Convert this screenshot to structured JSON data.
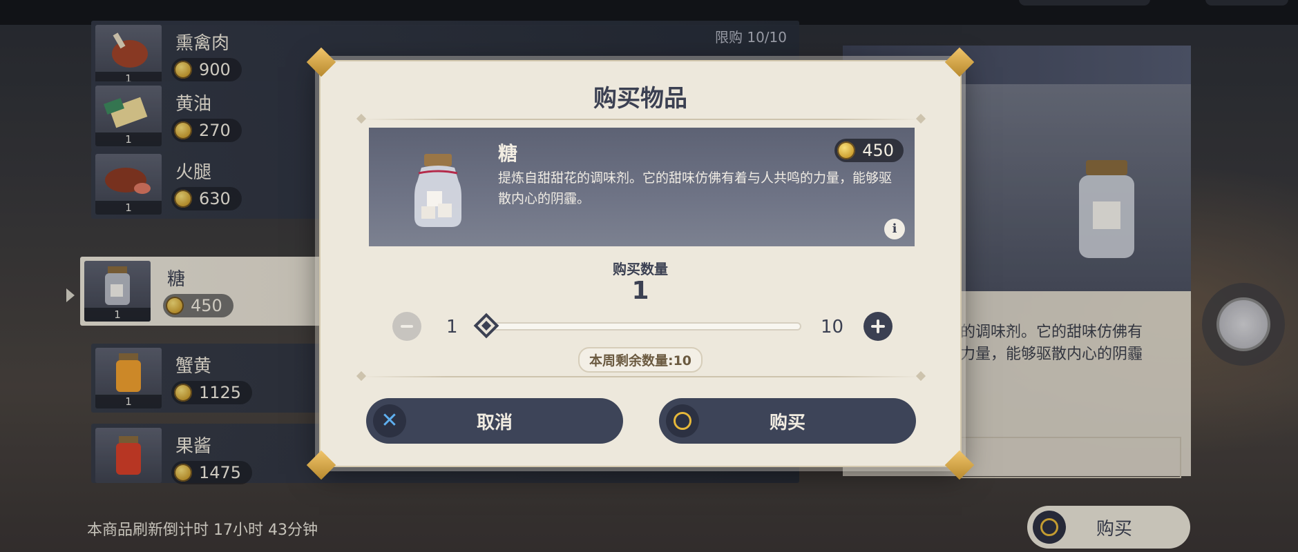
{
  "shop": {
    "items": [
      {
        "name": "熏禽肉",
        "price": "900",
        "qty": "1",
        "limit": "限购 10/10"
      },
      {
        "name": "黄油",
        "price": "270",
        "qty": "1"
      },
      {
        "name": "火腿",
        "price": "630",
        "qty": "1"
      },
      {
        "name": "糖",
        "price": "450",
        "qty": "1"
      },
      {
        "name": "蟹黄",
        "price": "1125",
        "qty": "1"
      },
      {
        "name": "果酱",
        "price": "1475",
        "qty": "1"
      }
    ],
    "refresh_text": "本商品刷新倒计时 17小时 43分钟",
    "buy_label": "购买"
  },
  "detail": {
    "desc": "的调味剂。它的甜味仿佛有\n力量，能够驱散内心的阴霾"
  },
  "dialog": {
    "title": "购买物品",
    "item": {
      "name": "糖",
      "price": "450",
      "desc": "提炼自甜甜花的调味剂。它的甜味仿佛有着与人共鸣的力量，能够驱散内心的阴霾。"
    },
    "qty_label": "购买数量",
    "qty_value": "1",
    "slider_min": "1",
    "slider_max": "10",
    "remaining": "本周剩余数量:10",
    "cancel_label": "取消",
    "confirm_label": "购买"
  },
  "colors": {
    "accent_dark": "#3b4052",
    "panel_bg": "#ede8dc",
    "coin_gold": "#e6b83a",
    "cancel_icon_blue": "#5fb0f0"
  },
  "icons": {
    "coin": "mora-coin-icon",
    "cancel": "x-icon",
    "confirm": "circle-icon",
    "info": "info-icon",
    "plus": "plus-icon",
    "minus": "minus-icon"
  }
}
